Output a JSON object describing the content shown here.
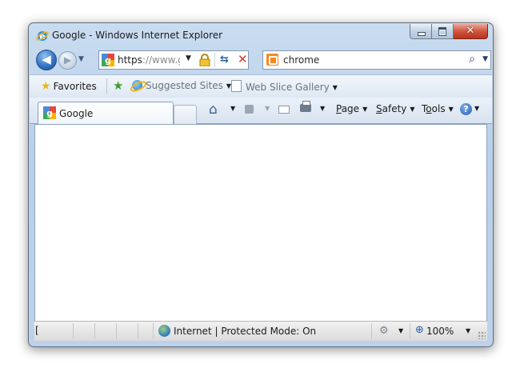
{
  "window": {
    "title": "Google - Windows Internet Explorer",
    "close_glyph": "✕"
  },
  "nav": {
    "back_glyph": "◀",
    "forward_glyph": "▶",
    "dropdown_glyph": "▼",
    "address_prefix": "https",
    "address_rest": "://www.g",
    "refresh_glyph": "⇆",
    "stop_glyph": "✕",
    "search_text": "chrome",
    "search_glyph": "⌕"
  },
  "favorites_bar": {
    "favorites_label": "Favorites",
    "suggested_sites_label": "Suggested Sites",
    "web_slice_label": "Web Slice Gallery"
  },
  "command_bar": {
    "tab_label": "Google",
    "page_label_u": "P",
    "page_label_rest": "age",
    "safety_label_u": "S",
    "safety_label_rest": "afety",
    "tools_label_pre": "T",
    "tools_label_u": "o",
    "tools_label_rest": "ols",
    "help_glyph": "?"
  },
  "status_bar": {
    "left_text": "[",
    "zone_text": "Internet | Protected Mode: On",
    "zoom_text": "100%"
  },
  "colors": {
    "frame": "#bdd2ea",
    "close_button": "#c8402a",
    "search_provider": "#f6891f"
  }
}
